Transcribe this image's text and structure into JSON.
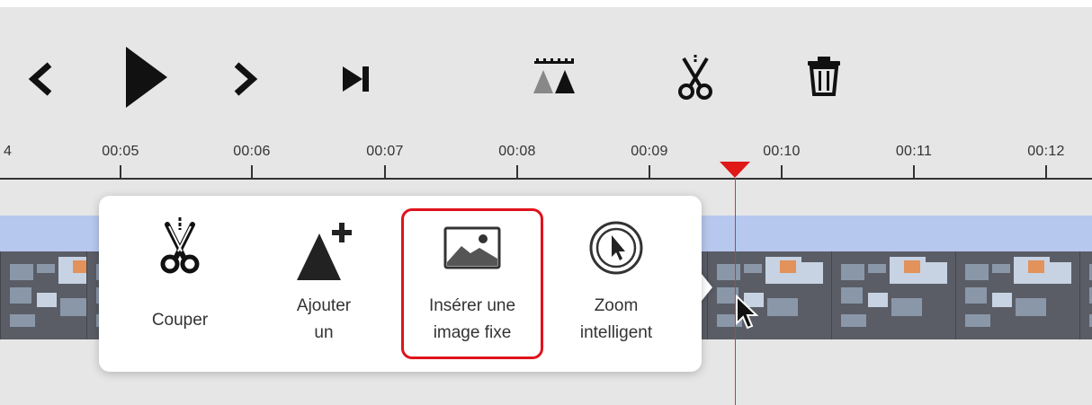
{
  "toolbar": {
    "buttons": [
      {
        "name": "previous-icon"
      },
      {
        "name": "play-icon"
      },
      {
        "name": "next-icon"
      },
      {
        "name": "skip-to-end-icon"
      },
      {
        "name": "split-clips-icon"
      },
      {
        "name": "cut-icon"
      },
      {
        "name": "trash-icon"
      }
    ]
  },
  "ruler": {
    "partial_label": "4",
    "labels": [
      "00:05",
      "00:06",
      "00:07",
      "00:08",
      "00:09",
      "00:10",
      "00:11",
      "00:12"
    ]
  },
  "playhead": {
    "color": "#e01818"
  },
  "popover": {
    "cut": {
      "icon": "scissors-icon",
      "label": "Couper"
    },
    "add": {
      "icon": "add-shape-icon",
      "label_line1": "Ajouter",
      "label_line2": "un"
    },
    "freeze": {
      "icon": "image-icon",
      "label_line1": "Insérer une",
      "label_line2": "image fixe"
    },
    "zoom": {
      "icon": "cursor-circle-icon",
      "label_line1": "Zoom",
      "label_line2": "intelligent"
    },
    "highlight_color": "#e0121c"
  },
  "colors": {
    "track_band": "#b7c8ee",
    "background": "#e6e6e6"
  }
}
